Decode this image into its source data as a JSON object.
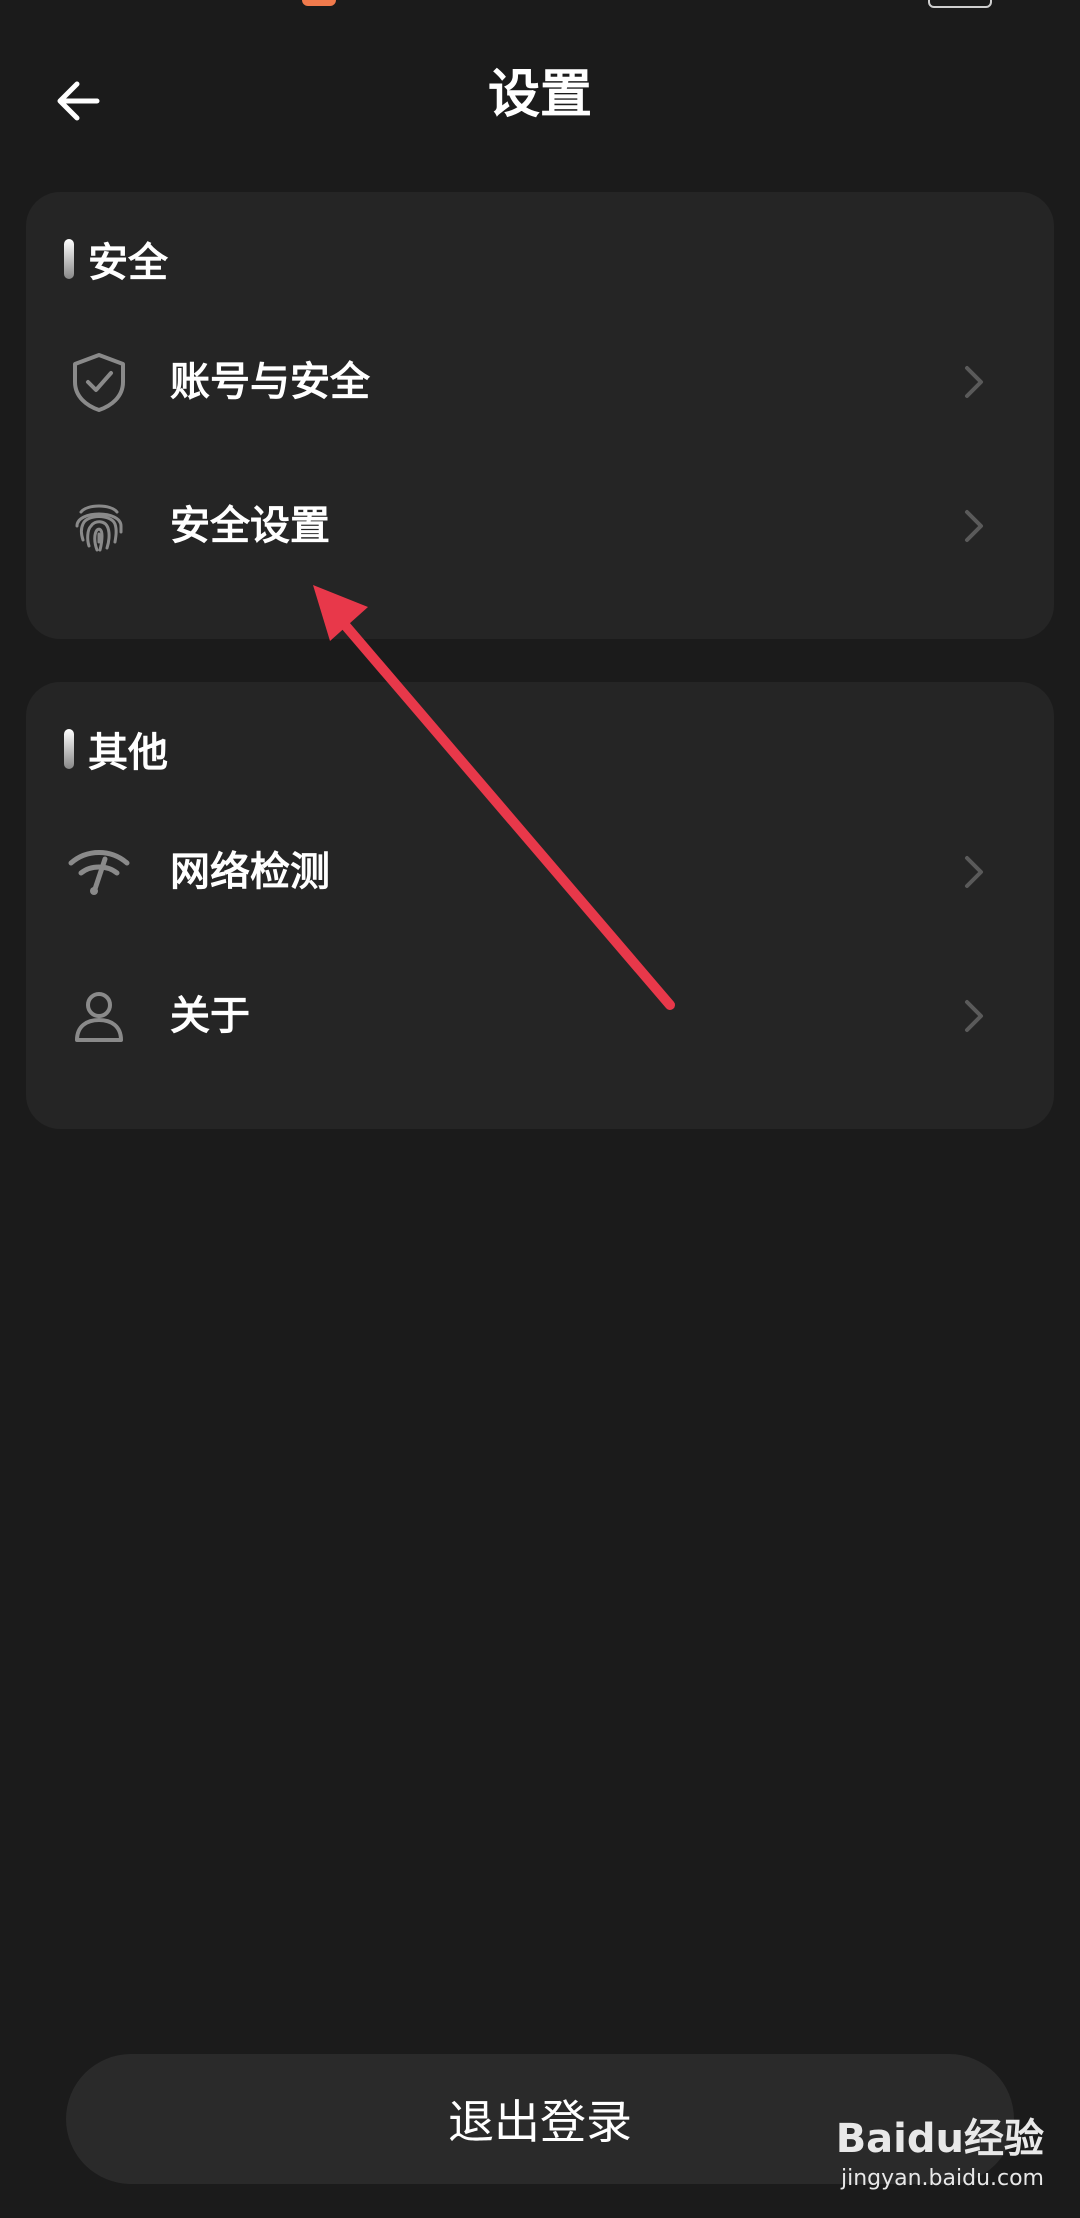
{
  "header": {
    "title": "设置"
  },
  "sections": [
    {
      "title": "安全",
      "items": [
        {
          "label": "账号与安全",
          "icon": "shield-check-icon"
        },
        {
          "label": "安全设置",
          "icon": "fingerprint-icon"
        }
      ]
    },
    {
      "title": "其他",
      "items": [
        {
          "label": "网络检测",
          "icon": "network-test-icon"
        },
        {
          "label": "关于",
          "icon": "person-icon"
        }
      ]
    }
  ],
  "logout": {
    "label": "退出登录"
  },
  "watermark": {
    "brand": "Baidu经验",
    "url": "jingyan.baidu.com"
  },
  "colors": {
    "background": "#1b1b1b",
    "card": "#252525",
    "annotation_arrow": "#e8384a",
    "icon_gray": "#8a8a8a",
    "chevron_gray": "#5a5a5a"
  }
}
